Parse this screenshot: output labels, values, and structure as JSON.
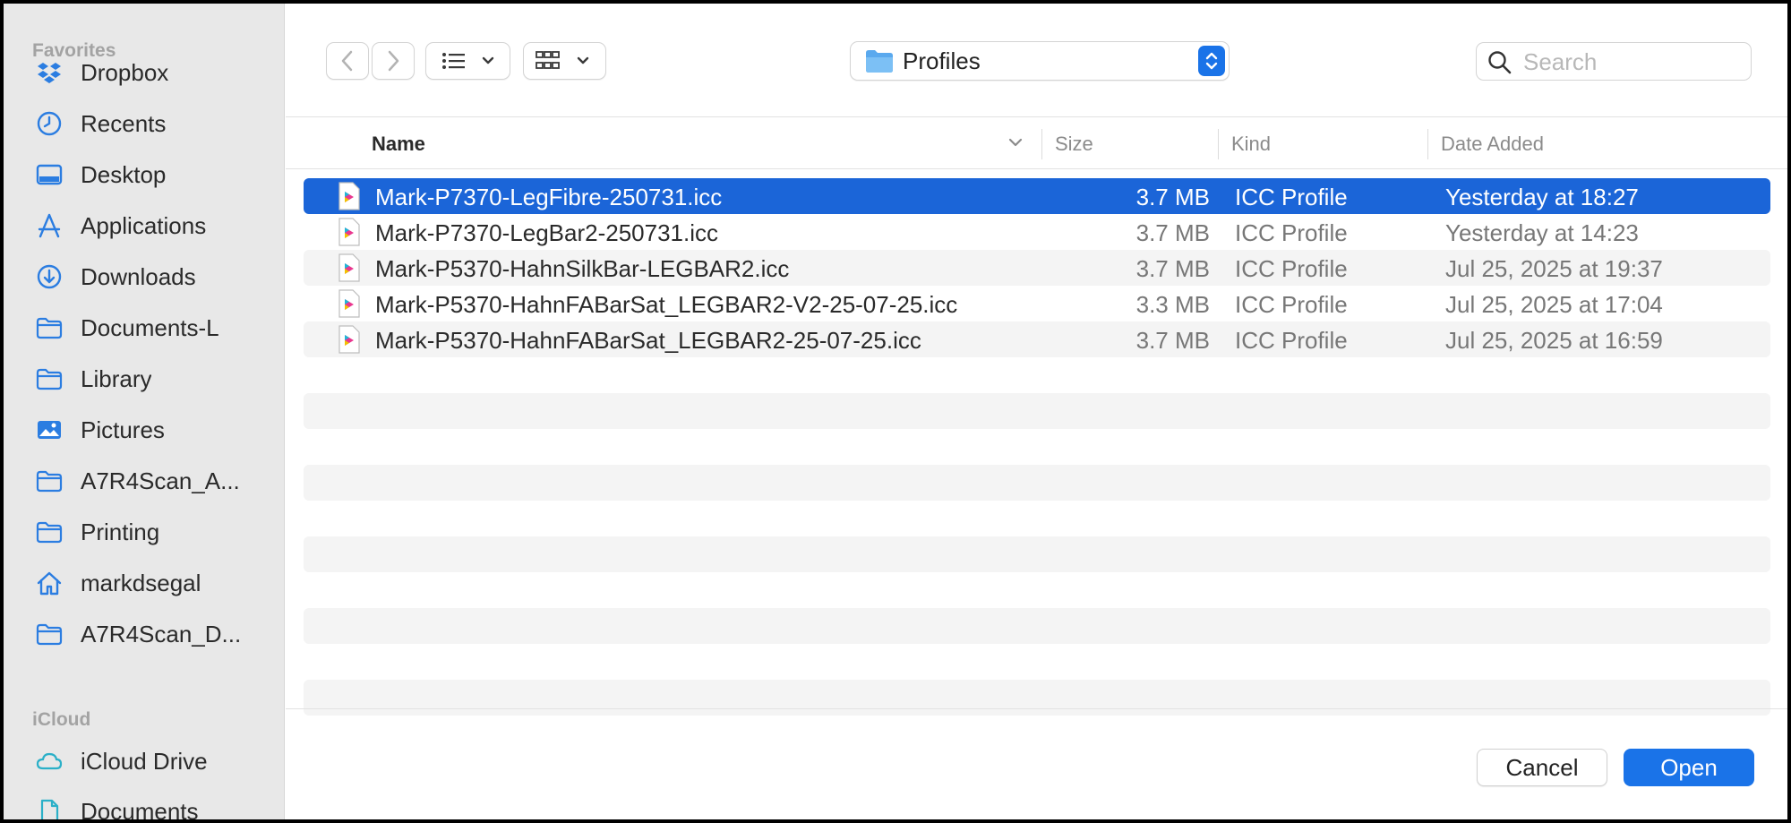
{
  "sidebar": {
    "favorites_title": "Favorites",
    "icloud_title": "iCloud",
    "favorites": [
      {
        "label": "Dropbox",
        "icon": "dropbox-icon"
      },
      {
        "label": "Recents",
        "icon": "clock-icon"
      },
      {
        "label": "Desktop",
        "icon": "desktop-icon"
      },
      {
        "label": "Applications",
        "icon": "applications-icon"
      },
      {
        "label": "Downloads",
        "icon": "download-icon"
      },
      {
        "label": "Documents-L",
        "icon": "folder-icon"
      },
      {
        "label": "Library",
        "icon": "folder-icon"
      },
      {
        "label": "Pictures",
        "icon": "pictures-icon"
      },
      {
        "label": "A7R4Scan_A...",
        "icon": "folder-icon"
      },
      {
        "label": "Printing",
        "icon": "folder-icon"
      },
      {
        "label": "markdsegal",
        "icon": "home-icon"
      },
      {
        "label": "A7R4Scan_D...",
        "icon": "folder-icon"
      }
    ],
    "icloud": [
      {
        "label": "iCloud Drive",
        "icon": "cloud-icon"
      },
      {
        "label": "Documents",
        "icon": "document-icon"
      }
    ]
  },
  "toolbar": {
    "location": "Profiles",
    "search_placeholder": "Search"
  },
  "columns": {
    "name": "Name",
    "size": "Size",
    "kind": "Kind",
    "date": "Date Added"
  },
  "files": [
    {
      "name": "Mark-P7370-LegFibre-250731.icc",
      "size": "3.7 MB",
      "kind": "ICC Profile",
      "date": "Yesterday at 18:27",
      "selected": true
    },
    {
      "name": "Mark-P7370-LegBar2-250731.icc",
      "size": "3.7 MB",
      "kind": "ICC Profile",
      "date": "Yesterday at 14:23",
      "selected": false
    },
    {
      "name": "Mark-P5370-HahnSilkBar-LEGBAR2.icc",
      "size": "3.7 MB",
      "kind": "ICC Profile",
      "date": "Jul 25, 2025 at 19:37",
      "selected": false
    },
    {
      "name": "Mark-P5370-HahnFABarSat_LEGBAR2-V2-25-07-25.icc",
      "size": "3.3 MB",
      "kind": "ICC Profile",
      "date": "Jul 25, 2025 at 17:04",
      "selected": false
    },
    {
      "name": "Mark-P5370-HahnFABarSat_LEGBAR2-25-07-25.icc",
      "size": "3.7 MB",
      "kind": "ICC Profile",
      "date": "Jul 25, 2025 at 16:59",
      "selected": false
    }
  ],
  "footer": {
    "cancel_label": "Cancel",
    "open_label": "Open"
  },
  "colors": {
    "accent": "#1a73e8",
    "selection": "#1b65d8",
    "sidebar_bg": "#e8e8e8",
    "icon_blue": "#2b7de1"
  }
}
